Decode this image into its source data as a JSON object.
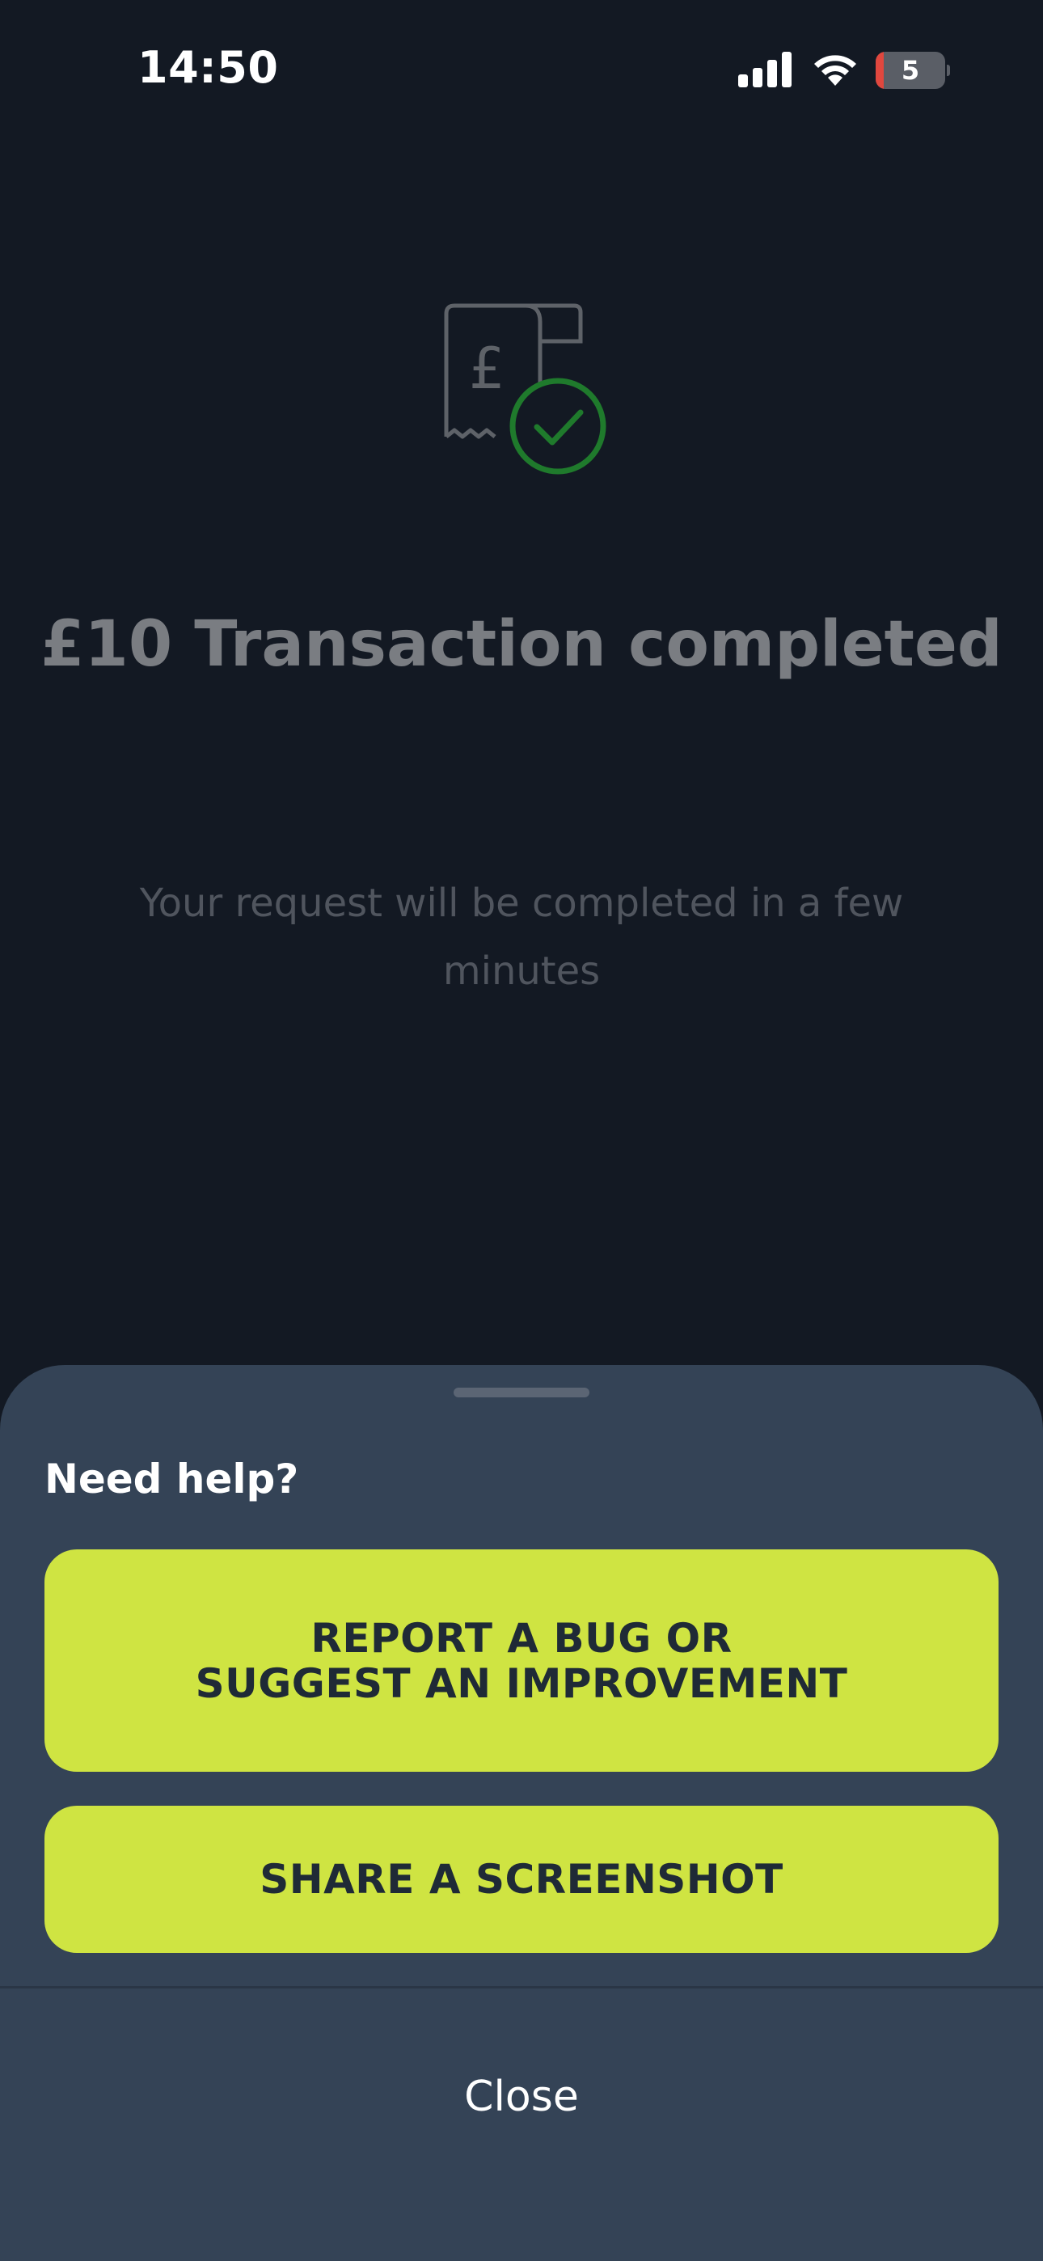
{
  "status_bar": {
    "time": "14:50",
    "battery_level": "5",
    "icons": [
      "signal-icon",
      "wifi-icon",
      "battery-icon"
    ]
  },
  "main": {
    "icon": "receipt-check-icon",
    "title": "£10 Transaction completed",
    "subtitle": "Your request will be completed in a few minutes"
  },
  "sheet": {
    "title": "Need help?",
    "report_button_line1": "REPORT A BUG OR",
    "report_button_line2": "SUGGEST AN IMPROVEMENT",
    "share_button": "SHARE A SCREENSHOT",
    "close_button": "Close"
  },
  "colors": {
    "background": "#131923",
    "sheet": "#344356",
    "accent": "#cfe442",
    "success": "#1f7a2c"
  }
}
